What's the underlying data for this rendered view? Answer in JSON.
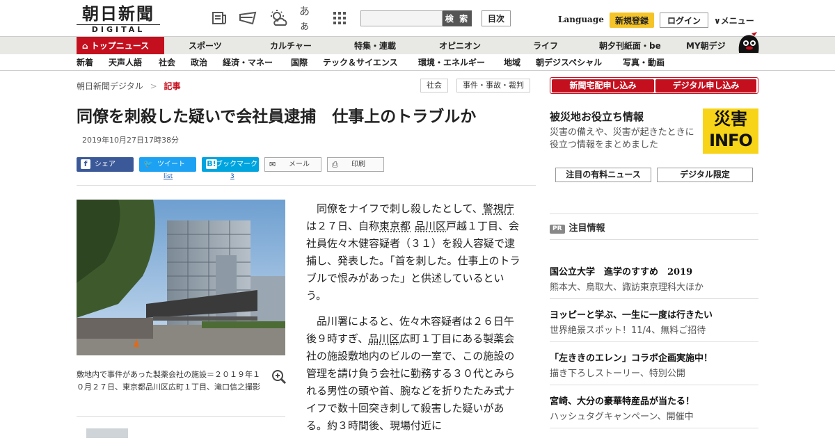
{
  "header": {
    "logo_jp": "朝日新聞",
    "logo_en": "DIGITAL",
    "search_button": "検 索",
    "toc_button": "目次",
    "language": "Language",
    "signup": "新規登録",
    "login": "ログイン",
    "menu": "メニュー",
    "icons": [
      "newspaper-icon",
      "paper-plane-icon",
      "weather-icon",
      "font-size-icon",
      "grid-icon"
    ],
    "font_size_glyph": "あぁ"
  },
  "nav_primary": [
    "トップニュース",
    "スポーツ",
    "カルチャー",
    "特集・連載",
    "オピニオン",
    "ライフ",
    "朝夕刊紙面・be",
    "MY朝デジ"
  ],
  "nav_secondary": [
    "新着",
    "天声人語",
    "社会",
    "政治",
    "経済・マネー",
    "国際",
    "テック＆サイエンス",
    "環境・エネルギー",
    "地域",
    "朝デジスペシャル",
    "写真・動画"
  ],
  "breadcrumb": {
    "home": "朝日新聞デジタル",
    "sep": ">",
    "current": "記事"
  },
  "tags": [
    "社会",
    "事件・事故・裁判"
  ],
  "article": {
    "headline": "同僚を刺殺した疑いで会社員逮捕　仕事上のトラブルか",
    "date": "2019年10月27日17時38分",
    "share": {
      "facebook": "シェア",
      "twitter": "ツイート",
      "twitter_count": "list",
      "hatena": "ブックマーク",
      "hatena_count": "3",
      "mail": "メール",
      "print": "印刷"
    },
    "caption": "敷地内で事件があった製薬会社の施設＝２０１９年１０月２７日、東京都品川区広町１丁目、滝口信之撮影",
    "p1_parts": [
      "同僚をナイフで刺し殺したとして、",
      "警視庁",
      "は２７日、自称",
      "東京都",
      "品川区",
      "戸越１丁目、会社員佐々木健容疑者（３１）を殺人容疑で逮捕し、発表した。「首を刺した。仕事上のトラブルで恨みがあった」と供述しているという。"
    ],
    "p2_parts": [
      "品川署によると、佐々木容疑者は２６日午後９時すぎ、",
      "品川区",
      "広町１丁目にある製薬会社の施設敷地内のビルの一室で、この施設の管理を請け負う会社に勤務する３０代とみられる男性の頭や首、腕などを折りたたみ式ナイフで数十回突き刺して殺害した疑いがある。約３時間後、現場付近に"
    ]
  },
  "sidebar": {
    "btn_delivery": "新聞宅配申し込み",
    "btn_digital": "デジタル申し込み",
    "disaster_title": "被災地お役立ち情報",
    "disaster_desc": "災害の備えや、災害が起きたときに役立つ情報をまとめました",
    "info_top": "災害",
    "info_bottom": "INFO",
    "box1": "注目の有料ニュース",
    "box2": "デジタル限定",
    "pr_badge": "PR",
    "pr_title": "注目情報",
    "pr_items": [
      {
        "title": "国公立大学　進学のすすめ　2019",
        "sub": "熊本大、鳥取大、諏訪東京理科大ほか"
      },
      {
        "title": "ヨッピーと学ぶ、一生に一度は行きたい",
        "sub": "世界絶景スポット！11/4、無料ご招待"
      },
      {
        "title": "「左ききのエレン」コラボ企画実施中！",
        "sub": "描き下ろしストーリー、特別公開"
      },
      {
        "title": "宮崎、大分の豪華特産品が当たる！",
        "sub": "ハッシュタグキャンペーン、開催中"
      }
    ]
  },
  "colors": {
    "brand_red": "#c4101e",
    "signup_yellow": "#f4c429",
    "facebook": "#3b5998",
    "twitter": "#1da1f2",
    "hatena": "#00a4de"
  }
}
